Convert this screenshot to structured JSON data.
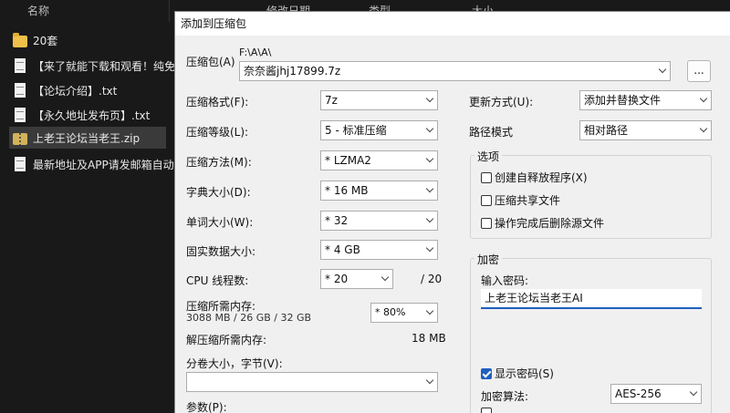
{
  "explorer": {
    "columns": [
      "名称",
      "修改日期",
      "类型",
      "大小"
    ],
    "files": [
      {
        "name": "20套",
        "icon": "folder-icon"
      },
      {
        "name": "【来了就能下载和观看！纯免费",
        "icon": "document-icon"
      },
      {
        "name": "【论坛介绍】.txt",
        "icon": "document-icon"
      },
      {
        "name": "【永久地址发布页】.txt",
        "icon": "document-icon"
      },
      {
        "name": "上老王论坛当老王.zip",
        "icon": "zip-icon",
        "selected": true
      },
      {
        "name": "最新地址及APP请发邮箱自动获",
        "icon": "document-icon"
      }
    ]
  },
  "dialog": {
    "title": "添加到压缩包",
    "archive_label": "压缩包(A)",
    "archive_path": "F:\\A\\A\\",
    "archive_name": "奈奈酱jhj17899.7z",
    "browse_label": "...",
    "format_label": "压缩格式(F):",
    "format_value": "7z",
    "level_label": "压缩等级(L):",
    "level_value": "5 - 标准压缩",
    "method_label": "压缩方法(M):",
    "method_value": "* LZMA2",
    "dict_label": "字典大小(D):",
    "dict_value": "* 16 MB",
    "word_label": "单词大小(W):",
    "word_value": "* 32",
    "solid_label": "固实数据大小:",
    "solid_value": "* 4 GB",
    "cpu_label": "CPU 线程数:",
    "cpu_value": "* 20",
    "cpu_max": "/ 20",
    "mem_label": "压缩所需内存:",
    "mem_detail": "3088 MB / 26 GB / 32 GB",
    "mem_percent": "* 80%",
    "decomp_label": "解压缩所需内存:",
    "decomp_value": "18 MB",
    "volume_label": "分卷大小，字节(V):",
    "volume_value": "",
    "params_label": "参数(P):",
    "update_label": "更新方式(U):",
    "update_value": "添加并替换文件",
    "path_label": "路径模式",
    "path_value": "相对路径",
    "options_title": "选项",
    "opt_sfx": "创建自释放程序(X)",
    "opt_shared": "压缩共享文件",
    "opt_delete": "操作完成后删除源文件",
    "encrypt_title": "加密",
    "password_label": "输入密码:",
    "password_value": "上老王论坛当老王AI",
    "show_password": "显示密码(S)",
    "enc_method_label": "加密算法:",
    "enc_method_value": "AES-256",
    "accent_color": "#1f5fbf"
  }
}
